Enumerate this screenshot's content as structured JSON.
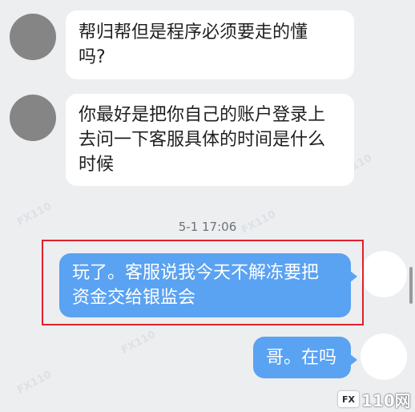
{
  "conversation": {
    "messages": [
      {
        "direction": "incoming",
        "lines": [
          "帮归帮但是程序必须要走的懂",
          "吗?"
        ]
      },
      {
        "direction": "incoming",
        "lines": [
          "你最好是把你自己的账户登录上",
          "去问一下客服具体的时间是什么",
          "时候"
        ]
      },
      {
        "direction": "outgoing",
        "lines": [
          "玩了。客服说我今天不解冻要把",
          "资金交给银监会"
        ]
      },
      {
        "direction": "outgoing",
        "lines": [
          "哥。在吗"
        ]
      }
    ],
    "timestamp": "5-1 17:06"
  },
  "watermark": {
    "logo_mark": "FX",
    "logo_text": "110网"
  },
  "colors": {
    "background": "#eceef0",
    "incoming_bubble": "#ffffff",
    "outgoing_bubble": "#5aa2f2",
    "highlight_border": "#e0202a",
    "avatar_gray": "#858585"
  }
}
